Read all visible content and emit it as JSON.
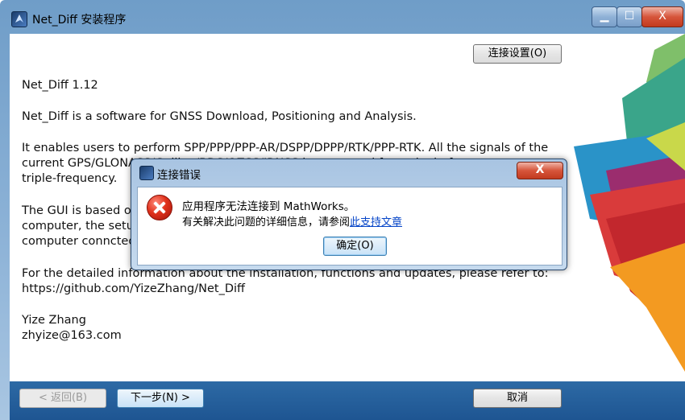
{
  "window": {
    "title": "Net_Diff 安装程序",
    "minimize_label": "▁",
    "maximize_label": "☐",
    "close_label": "X"
  },
  "connection_settings_label": "连接设置(O)",
  "content": {
    "line1": "Net_Diff 1.12",
    "line2": "Net_Diff is a software for GNSS Download, Positioning and Analysis.",
    "line3a": "It enables users to perform SPP/PPP/PPP-AR/DSPP/DPPP/RTK/PPP-RTK. All the signals of the",
    "line3b": "current GPS/GLONASS/Galileo/BDS/QZSS/IRNSS is supported from single-frequency to",
    "line3c": "triple-frequency.",
    "line4a": "The GUI is based on MATLAB Runtime. If the MATLAB Runtime is not installed on the",
    "line4b": "computer, the setup will download and install the MATLAB Runtime, so please keep the",
    "line4c": "computer conncted to Internet.",
    "line5a": "For the detailed information about the installation, functions and updates, please refer to:",
    "line5b": "https://github.com/YizeZhang/Net_Diff",
    "line6a": "Yize Zhang",
    "line6b": "zhyize@163.com"
  },
  "footer": {
    "back_label": "< 返回(B)",
    "next_label": "下一步(N) >",
    "cancel_label": "取消"
  },
  "dialog": {
    "title": "连接错误",
    "close_label": "X",
    "message_line1": "应用程序无法连接到 MathWorks。",
    "message_line2_prefix": "有关解决此问题的详细信息，请参阅",
    "message_link": "此支持文章",
    "ok_label": "确定(O)",
    "icon": "error-icon"
  },
  "colors": {
    "footer": "#1e5592",
    "error": "#e0321c",
    "link": "#0645c8"
  }
}
